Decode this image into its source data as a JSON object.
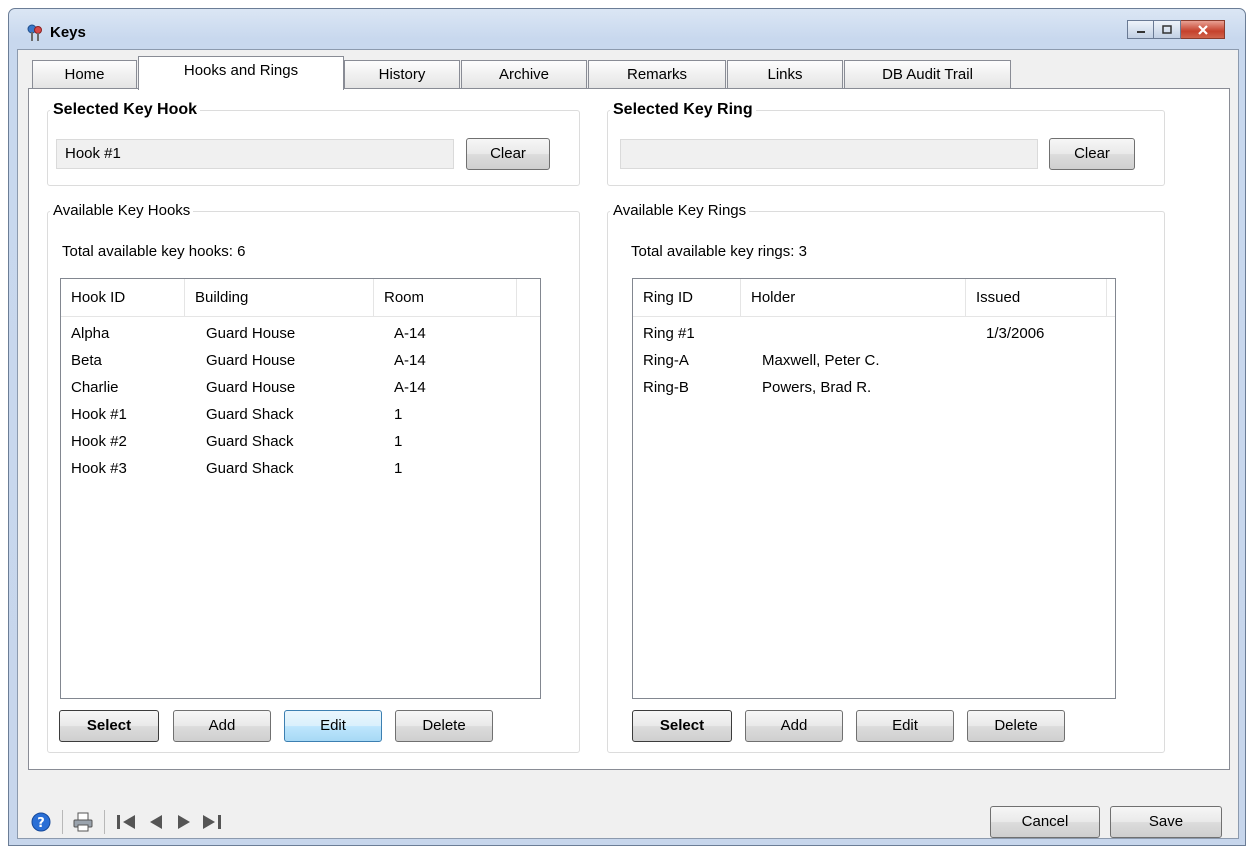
{
  "window": {
    "title": "Keys",
    "icon": "keys-app-icon"
  },
  "tabs": [
    {
      "label": "Home"
    },
    {
      "label": "Hooks and Rings"
    },
    {
      "label": "History"
    },
    {
      "label": "Archive"
    },
    {
      "label": "Remarks"
    },
    {
      "label": "Links"
    },
    {
      "label": "DB Audit Trail"
    }
  ],
  "active_tab": "Hooks and Rings",
  "selected_hook": {
    "title": "Selected Key Hook",
    "value": "Hook #1",
    "clear_label": "Clear"
  },
  "selected_ring": {
    "title": "Selected Key Ring",
    "value": "",
    "clear_label": "Clear"
  },
  "hooks": {
    "title": "Available Key Hooks",
    "total_text": "Total available key hooks: 6",
    "columns": [
      "Hook ID",
      "Building",
      "Room"
    ],
    "rows": [
      [
        "Alpha",
        "Guard House",
        "A-14"
      ],
      [
        "Beta",
        "Guard House",
        "A-14"
      ],
      [
        "Charlie",
        "Guard House",
        "A-14"
      ],
      [
        "Hook #1",
        "Guard Shack",
        "1"
      ],
      [
        "Hook #2",
        "Guard Shack",
        "1"
      ],
      [
        "Hook #3",
        "Guard Shack",
        "1"
      ]
    ],
    "buttons": {
      "select": "Select",
      "add": "Add",
      "edit": "Edit",
      "delete": "Delete"
    }
  },
  "rings": {
    "title": "Available Key Rings",
    "total_text": "Total available key rings: 3",
    "columns": [
      "Ring ID",
      "Holder",
      "Issued"
    ],
    "rows": [
      [
        "Ring #1",
        "",
        "1/3/2006"
      ],
      [
        "Ring-A",
        "Maxwell, Peter C.",
        ""
      ],
      [
        "Ring-B",
        "Powers, Brad R.",
        ""
      ]
    ],
    "buttons": {
      "select": "Select",
      "add": "Add",
      "edit": "Edit",
      "delete": "Delete"
    }
  },
  "footer": {
    "icons": [
      "help-icon",
      "print-icon",
      "first-record-icon",
      "previous-record-icon",
      "next-record-icon",
      "last-record-icon"
    ],
    "cancel_label": "Cancel",
    "save_label": "Save"
  },
  "colors": {
    "help": "#2a6fd6",
    "accent_focus": "#3c7fb1",
    "close_button": "#c5412c"
  }
}
